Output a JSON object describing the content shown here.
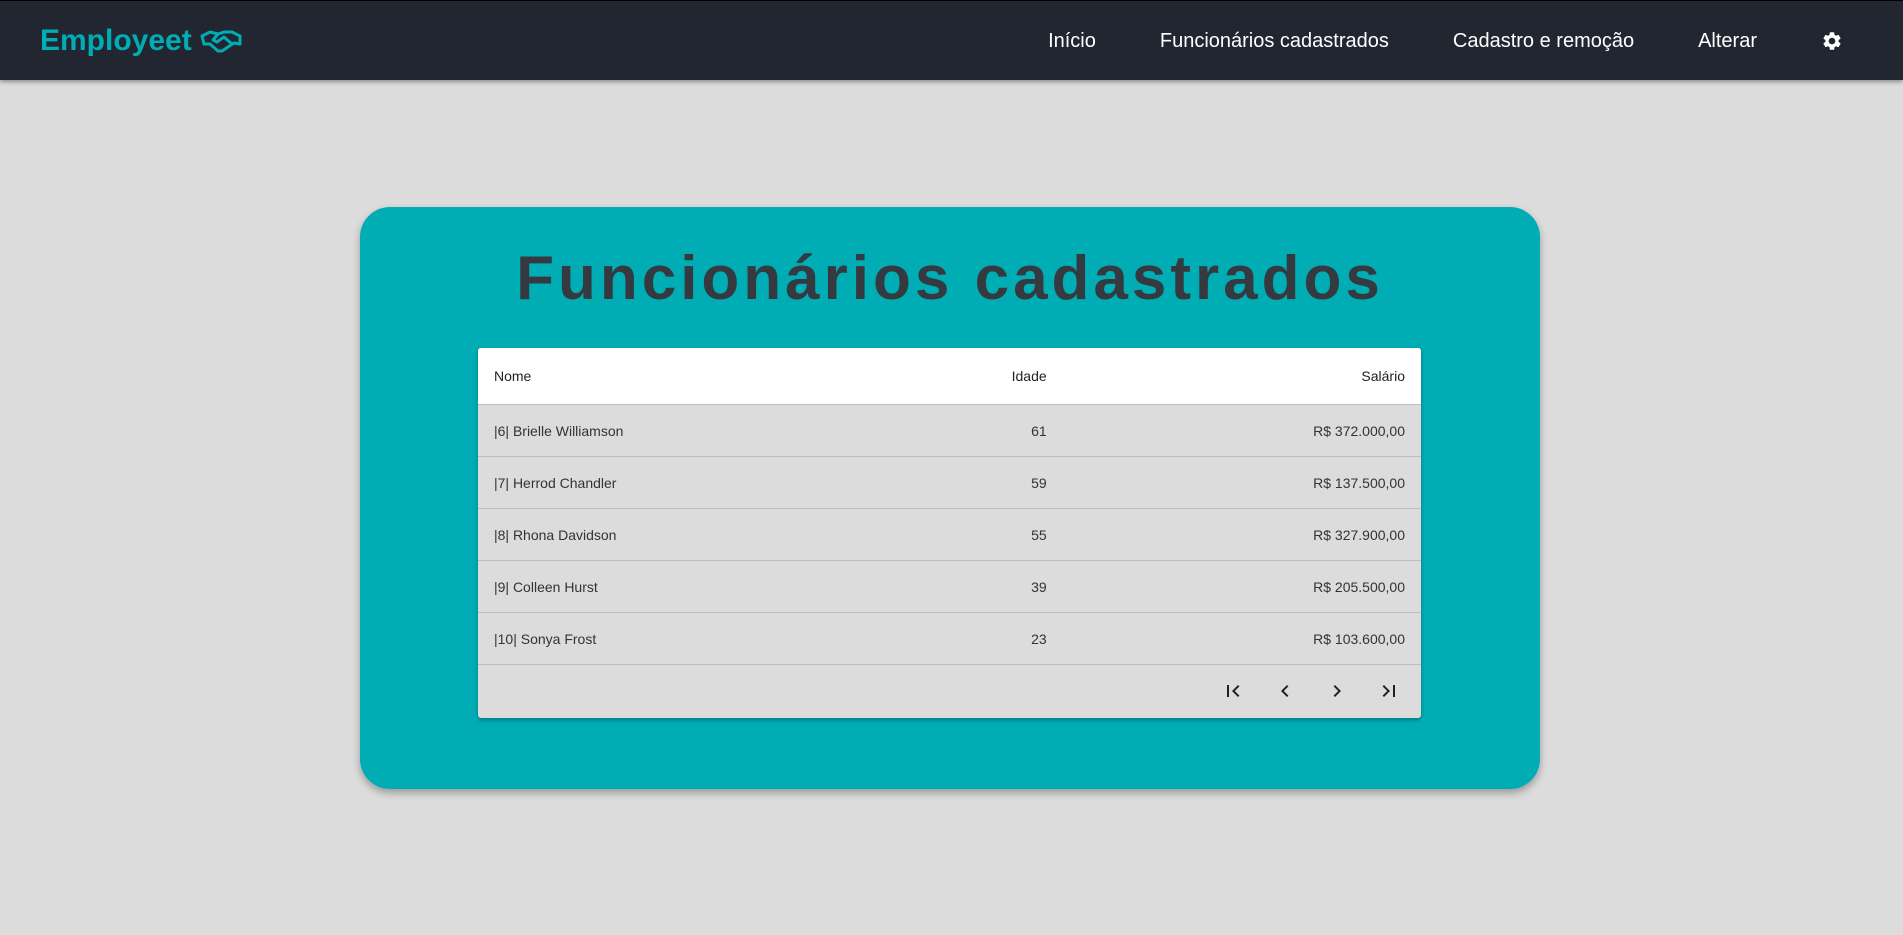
{
  "navbar": {
    "brand": "Employeet",
    "brand_icon": "handshake-icon",
    "links": [
      {
        "label": "Início"
      },
      {
        "label": "Funcionários cadastrados"
      },
      {
        "label": "Cadastro e remoção"
      },
      {
        "label": "Alterar"
      }
    ],
    "settings_icon": "gear-icon"
  },
  "main": {
    "title": "Funcionários cadastrados",
    "table": {
      "headers": {
        "nome": "Nome",
        "idade": "Idade",
        "salario": "Salário"
      },
      "rows": [
        {
          "nome": "|6| Brielle Williamson",
          "idade": "61",
          "salario": "R$ 372.000,00"
        },
        {
          "nome": "|7| Herrod Chandler",
          "idade": "59",
          "salario": "R$ 137.500,00"
        },
        {
          "nome": "|8| Rhona Davidson",
          "idade": "55",
          "salario": "R$ 327.900,00"
        },
        {
          "nome": "|9| Colleen Hurst",
          "idade": "39",
          "salario": "R$ 205.500,00"
        },
        {
          "nome": "|10| Sonya Frost",
          "idade": "23",
          "salario": "R$ 103.600,00"
        }
      ]
    },
    "paginator": {
      "first_icon": "first-page-icon",
      "prev_icon": "chevron-left-icon",
      "next_icon": "chevron-right-icon",
      "last_icon": "last-page-icon"
    }
  },
  "colors": {
    "navbar_bg": "#212631",
    "accent": "#00adb5",
    "page_bg": "#dcdcdc",
    "title": "#343a40"
  }
}
